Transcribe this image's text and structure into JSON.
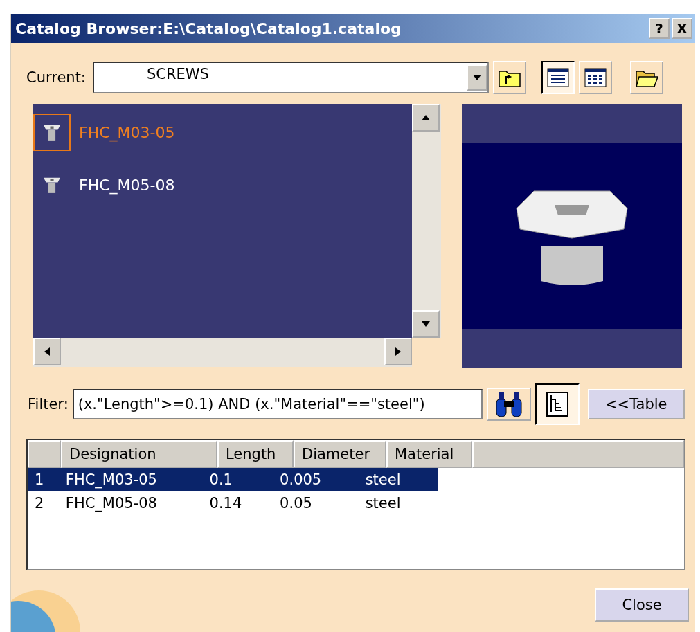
{
  "window": {
    "title": "Catalog Browser:E:\\Catalog\\Catalog1.catalog",
    "help": "?",
    "close": "X"
  },
  "current": {
    "label": "Current:",
    "value": "SCREWS"
  },
  "view_modes": [
    {
      "selected": true
    },
    {
      "selected": false
    }
  ],
  "items": [
    {
      "label": "FHC_M03-05",
      "selected": true
    },
    {
      "label": "FHC_M05-08",
      "selected": false
    }
  ],
  "filter": {
    "label": "Filter:",
    "value": "(x.\"Length\">=0.1) AND (x.\"Material\"==\"steel\")",
    "tree_pressed": true,
    "table_button": "<<Table"
  },
  "table": {
    "columns": [
      "Designation",
      "Length",
      "Diameter",
      "Material"
    ],
    "rows": [
      {
        "index": "1",
        "cells": [
          "FHC_M03-05",
          "0.1",
          "0.005",
          "steel"
        ],
        "selected": true
      },
      {
        "index": "2",
        "cells": [
          "FHC_M05-08",
          "0.14",
          "0.05",
          "steel"
        ],
        "selected": false
      }
    ]
  },
  "close_button": "Close"
}
